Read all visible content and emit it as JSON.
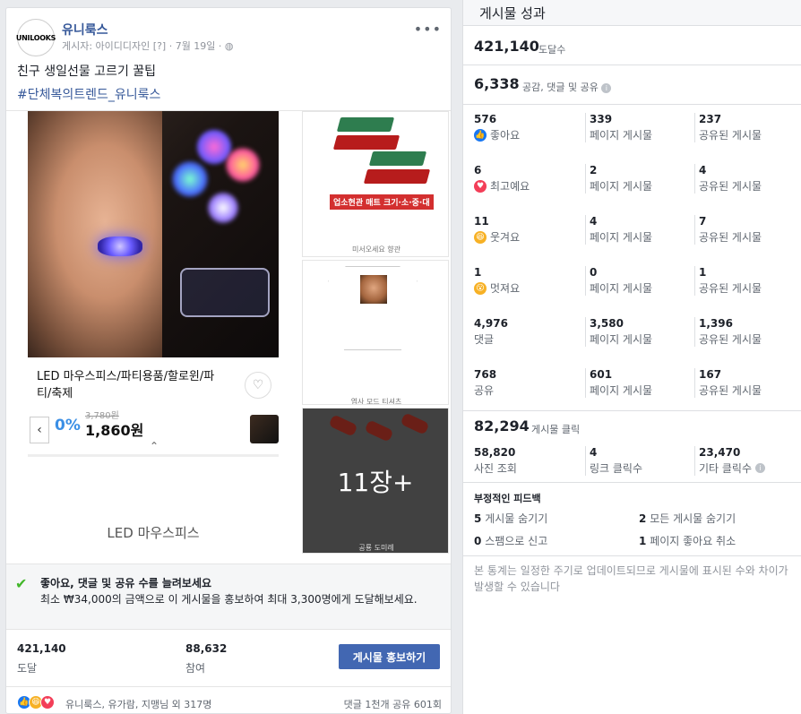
{
  "post": {
    "page_name": "유니룩스",
    "avatar_text": "UNILOOKS",
    "meta": "게시자: 아이디디자인 [?] · 7월 19일 · ",
    "more": "•••",
    "text": "친구 생일선물 고르기 꿀팁",
    "hashtag": "#단체복의트렌드_유니룩스",
    "product": {
      "title": "LED 마우스피스/파티용품/할로윈/파티/축제",
      "old_price": "3,780원",
      "discount": "0%",
      "new_price": "1,860원",
      "caption": "LED 마우스피스"
    },
    "side1": {
      "label": "업소현관 매트 크기·소·중·대",
      "caption": "미서오세요 향관"
    },
    "side2": {
      "caption": "엽사 모드 티셔츠"
    },
    "side3": {
      "overlay": "11장+",
      "caption": "공룡 도미례"
    },
    "promo": {
      "title": "좋아요, 댓글 및 공유 수를 늘려보세요",
      "desc": "최소 ₩34,000의 금액으로 이 게시물을 홍보하여 최대 3,300명에게 도달해보세요."
    },
    "stats": {
      "reach_num": "421,140",
      "reach_lbl": "도달",
      "engage_num": "88,632",
      "engage_lbl": "참여",
      "boost_label": "게시물 홍보하기"
    },
    "reactions": {
      "names": "유니룩스, 유가람, 지맹님 외 317명",
      "counts": "댓글 1천개   공유 601회"
    }
  },
  "perf": {
    "title": "게시물 성과",
    "reach_num": "421,140",
    "reach_lbl": "도달수",
    "engage_num": "6,338",
    "engage_lbl": "공감, 댓글 및 공유",
    "rows": [
      {
        "n1": "576",
        "l1": "좋아요",
        "n2": "339",
        "l2": "페이지 게시물",
        "n3": "237",
        "l3": "공유된 게시물"
      },
      {
        "n1": "6",
        "l1": "최고예요",
        "n2": "2",
        "l2": "페이지 게시물",
        "n3": "4",
        "l3": "공유된 게시물"
      },
      {
        "n1": "11",
        "l1": "웃겨요",
        "n2": "4",
        "l2": "페이지 게시물",
        "n3": "7",
        "l3": "공유된 게시물"
      },
      {
        "n1": "1",
        "l1": "멋져요",
        "n2": "0",
        "l2": "페이지 게시물",
        "n3": "1",
        "l3": "공유된 게시물"
      },
      {
        "n1": "4,976",
        "l1": "댓글",
        "n2": "3,580",
        "l2": "페이지 게시물",
        "n3": "1,396",
        "l3": "공유된 게시물"
      },
      {
        "n1": "768",
        "l1": "공유",
        "n2": "601",
        "l2": "페이지 게시물",
        "n3": "167",
        "l3": "공유된 게시물"
      }
    ],
    "clicks_num": "82,294",
    "clicks_lbl": "게시물 클릭",
    "click_breakdown": [
      {
        "n": "58,820",
        "l": "사진 조회"
      },
      {
        "n": "4",
        "l": "링크 클릭수"
      },
      {
        "n": "23,470",
        "l": "기타 클릭수"
      }
    ],
    "feedback_title": "부정적인 피드백",
    "feedback": [
      {
        "n": "5",
        "l": "게시물 숨기기"
      },
      {
        "n": "2",
        "l": "모든 게시물 숨기기"
      },
      {
        "n": "0",
        "l": "스팸으로 신고"
      },
      {
        "n": "1",
        "l": "페이지 좋아요 취소"
      }
    ],
    "note": "본 통계는 일정한 주기로 업데이트되므로 게시물에 표시된 수와 차이가 발생할 수 있습니다"
  },
  "colors": {
    "link": "#365899",
    "button": "#4267b2",
    "like": "#1877f2",
    "love": "#f33e58",
    "haha": "#f7b125"
  }
}
